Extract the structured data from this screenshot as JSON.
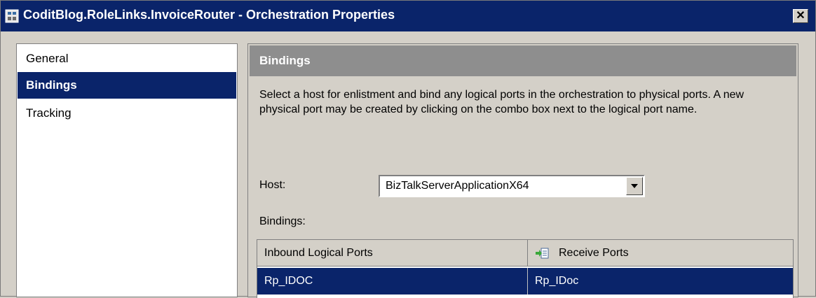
{
  "window": {
    "title": "CoditBlog.RoleLinks.InvoiceRouter - Orchestration Properties",
    "close_label": "✕"
  },
  "nav": {
    "items": [
      {
        "label": "General",
        "selected": false
      },
      {
        "label": "Bindings",
        "selected": true
      },
      {
        "label": "Tracking",
        "selected": false
      }
    ]
  },
  "bindings_page": {
    "header": "Bindings",
    "description": "Select a host for enlistment and bind any logical ports in the orchestration to physical ports. A new physical port may be created by clicking on the combo box next to the logical port name.",
    "host_label": "Host:",
    "host_value": "BizTalkServerApplicationX64",
    "bindings_label": "Bindings:",
    "grid": {
      "columns": [
        "Inbound Logical Ports",
        "Receive Ports"
      ],
      "rows": [
        {
          "logical_port": "Rp_IDOC",
          "physical_port": "Rp_IDoc",
          "selected": true
        }
      ]
    }
  },
  "colors": {
    "title_bar": "#0a246a",
    "selection": "#0a246a",
    "section_header": "#8e8e8e",
    "window_face": "#d4d0c8"
  },
  "icons": {
    "app": "orchestration-icon",
    "close": "close-icon",
    "dropdown": "dropdown-arrow-icon",
    "receive_port": "receive-port-icon"
  }
}
